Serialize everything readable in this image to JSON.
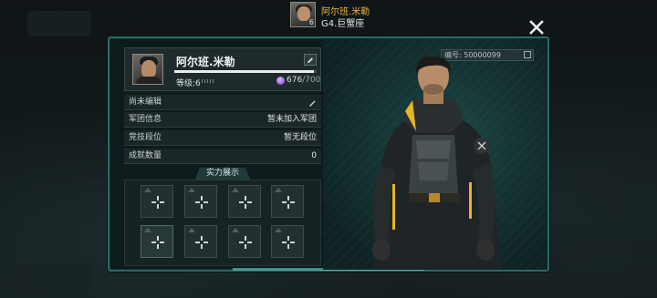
{
  "header": {
    "player_name": "阿尔班.米勒",
    "player_level": "6",
    "subtitle": "G4.巨蟹座"
  },
  "profile": {
    "name": "阿尔班.米勒",
    "level_label": "等级:6",
    "xp_progress": 0.98,
    "energy_current": "676",
    "energy_max": "/700",
    "id_label": "编号: 50000099"
  },
  "info_rows": [
    {
      "label": "尚未编辑",
      "value": ""
    },
    {
      "label": "军团信息",
      "value": "暂未加入军团"
    },
    {
      "label": "竞技段位",
      "value": "暂无段位"
    },
    {
      "label": "成就数量",
      "value": "0"
    }
  ],
  "showcase": {
    "title": "实力展示",
    "slots": 8
  },
  "colors": {
    "accent": "#2c6a67",
    "name_gold": "#f0b23a",
    "gem": "#7a3fd1"
  }
}
